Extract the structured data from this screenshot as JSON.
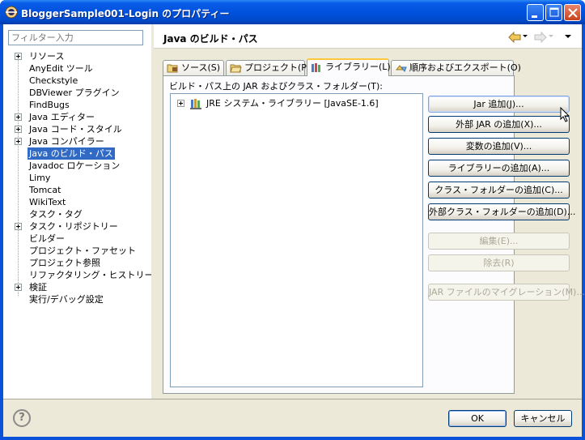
{
  "window": {
    "title": "BloggerSample001-Login のプロパティー"
  },
  "filter": {
    "placeholder": "フィルター入力"
  },
  "tree": [
    {
      "label": "リソース",
      "expandable": true
    },
    {
      "label": "AnyEdit ツール",
      "expandable": false
    },
    {
      "label": "Checkstyle",
      "expandable": false
    },
    {
      "label": "DBViewer プラグイン",
      "expandable": false
    },
    {
      "label": "FindBugs",
      "expandable": false
    },
    {
      "label": "Java エディター",
      "expandable": true
    },
    {
      "label": "Java コード・スタイル",
      "expandable": true
    },
    {
      "label": "Java コンパイラー",
      "expandable": true
    },
    {
      "label": "Java のビルド・パス",
      "expandable": false,
      "selected": true
    },
    {
      "label": "Javadoc ロケーション",
      "expandable": false
    },
    {
      "label": "Limy",
      "expandable": false
    },
    {
      "label": "Tomcat",
      "expandable": false
    },
    {
      "label": "WikiText",
      "expandable": false
    },
    {
      "label": "タスク・タグ",
      "expandable": false
    },
    {
      "label": "タスク・リポジトリー",
      "expandable": true
    },
    {
      "label": "ビルダー",
      "expandable": false
    },
    {
      "label": "プロジェクト・ファセット",
      "expandable": false
    },
    {
      "label": "プロジェクト参照",
      "expandable": false
    },
    {
      "label": "リファクタリング・ヒストリー",
      "expandable": false
    },
    {
      "label": "検証",
      "expandable": true
    },
    {
      "label": "実行/デバッグ設定",
      "expandable": false
    }
  ],
  "header": {
    "title": "Java のビルド・パス"
  },
  "tabs": [
    {
      "label": "ソース(S)",
      "icon": "source-folder-icon"
    },
    {
      "label": "プロジェクト(P)",
      "icon": "project-folder-icon"
    },
    {
      "label": "ライブラリー(L)",
      "icon": "library-icon",
      "active": true
    },
    {
      "label": "順序およびエクスポート(O)",
      "icon": "order-export-icon"
    }
  ],
  "libraries": {
    "section_label": "ビルド・パス上の JAR およびクラス・フォルダー(T):",
    "items": [
      {
        "label": "JRE システム・ライブラリー [JavaSE-1.6]"
      }
    ]
  },
  "buttons": {
    "add_jar": "Jar 追加(J)...",
    "add_external_jar": "外部 JAR の追加(X)...",
    "add_variable": "変数の追加(V)...",
    "add_library": "ライブラリーの追加(A)...",
    "add_class_folder": "クラス・フォルダーの追加(C)...",
    "add_external_class_folder": "外部クラス・フォルダーの追加(D)...",
    "edit": "編集(E)...",
    "remove": "除去(R)",
    "migrate_jar": "JAR ファイルのマイグレーション(M)..."
  },
  "footer": {
    "help": "?",
    "ok": "OK",
    "cancel": "キャンセル"
  },
  "colors": {
    "titlebar": "#0052de",
    "selection": "#316ac5",
    "active_tab_accent": "#ffc83c",
    "dialog_bg": "#ece9d8"
  }
}
